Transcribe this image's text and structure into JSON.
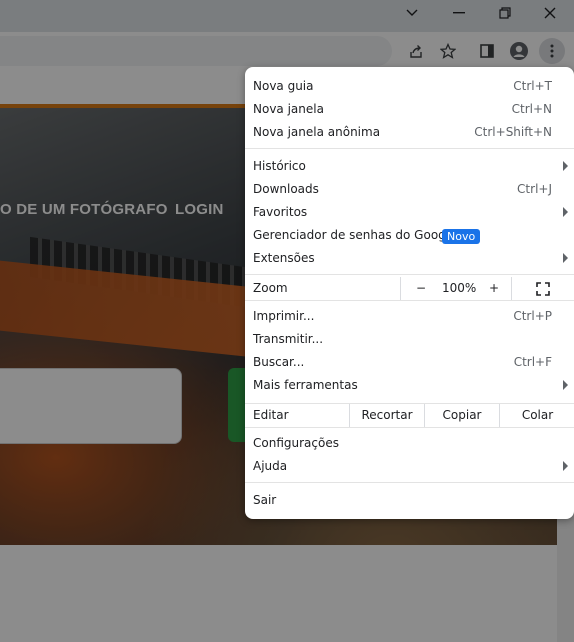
{
  "page": {
    "nav_item_1": "O DE UM FOTÓGRAFO",
    "nav_item_2": "LOGIN"
  },
  "menu": {
    "new_tab": {
      "label": "Nova guia",
      "shortcut": "Ctrl+T"
    },
    "new_window": {
      "label": "Nova janela",
      "shortcut": "Ctrl+N"
    },
    "incognito": {
      "label": "Nova janela anônima",
      "shortcut": "Ctrl+Shift+N"
    },
    "history": {
      "label": "Histórico"
    },
    "downloads": {
      "label": "Downloads",
      "shortcut": "Ctrl+J"
    },
    "bookmarks": {
      "label": "Favoritos"
    },
    "password_manager": {
      "label": "Gerenciador de senhas do Google",
      "badge": "Novo"
    },
    "extensions": {
      "label": "Extensões"
    },
    "zoom": {
      "label": "Zoom",
      "minus": "−",
      "value": "100%",
      "plus": "+"
    },
    "print": {
      "label": "Imprimir...",
      "shortcut": "Ctrl+P"
    },
    "cast": {
      "label": "Transmitir..."
    },
    "find": {
      "label": "Buscar...",
      "shortcut": "Ctrl+F"
    },
    "more_tools": {
      "label": "Mais ferramentas"
    },
    "edit": {
      "label": "Editar",
      "cut": "Recortar",
      "copy": "Copiar",
      "paste": "Colar"
    },
    "settings": {
      "label": "Configurações"
    },
    "help": {
      "label": "Ajuda"
    },
    "exit": {
      "label": "Sair"
    }
  },
  "colors": {
    "badge": "#1a73e8",
    "accent_orange": "#d97a16",
    "green_button": "#2e9e45"
  }
}
